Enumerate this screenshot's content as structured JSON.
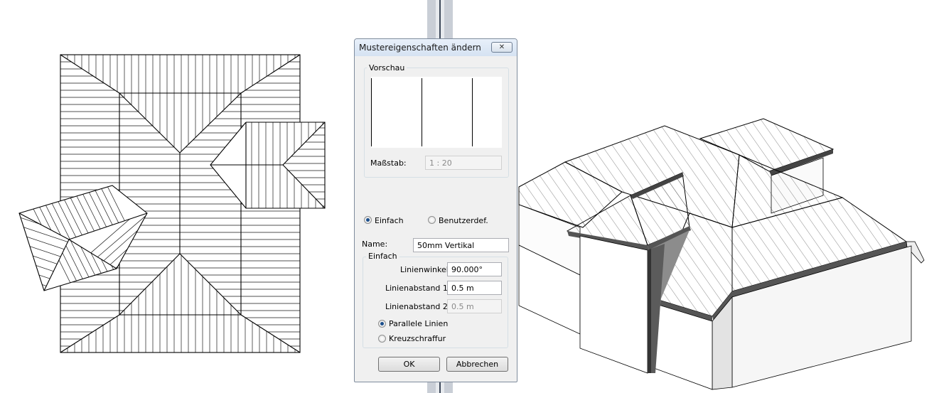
{
  "dialog": {
    "title": "Mustereigenschaften ändern",
    "close_glyph": "✕",
    "preview_group_label": "Vorschau",
    "scale_label": "Maßstab:",
    "scale_value": "1 : 20",
    "radio_simple_label": "Einfach",
    "radio_custom_label": "Benutzerdef.",
    "name_label": "Name:",
    "name_value": "50mm Vertikal",
    "simple_group_label": "Einfach",
    "line_angle_label": "Linienwinkel:",
    "line_angle_value": "90.000°",
    "line_spacing1_label": "Linienabstand 1:",
    "line_spacing1_value": "0.5 m",
    "line_spacing2_label": "Linienabstand 2:",
    "line_spacing2_value": "0.5 m",
    "parallel_lines_label": "Parallele Linien",
    "crosshatch_label": "Kreuzschraffur",
    "ok_label": "OK",
    "cancel_label": "Abbrechen",
    "selected_fill_type": "Einfach",
    "selected_hatch_mode": "Parallele Linien"
  }
}
